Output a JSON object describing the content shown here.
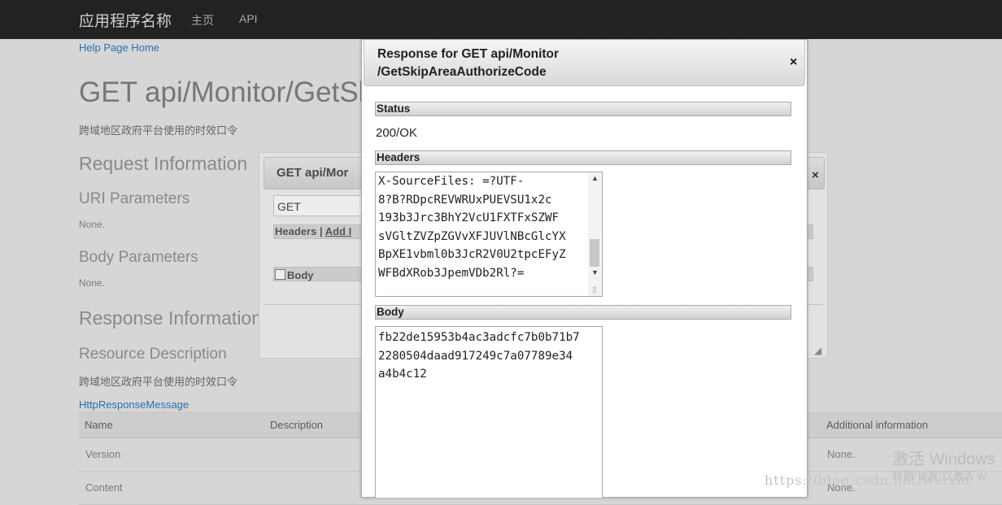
{
  "navbar": {
    "brand": "应用程序名称",
    "links": [
      "主页",
      "API"
    ]
  },
  "help_page": {
    "home_link": "Help Page Home",
    "title": "GET api/Monitor/GetSk",
    "subtitle": "跨域地区政府平台使用的时效口令",
    "request_info": "Request Information",
    "uri_params": "URI Parameters",
    "uri_params_value": "None.",
    "body_params": "Body Parameters",
    "body_params_value": "None.",
    "response_info": "Response Information",
    "resource_desc": "Resource Description",
    "resource_desc_text": "跨域地区政府平台使用的时效口令",
    "response_type_link": "HttpResponseMessage",
    "table": {
      "headers": [
        "Name",
        "Description",
        "Additional information"
      ],
      "rows": [
        {
          "name": "Version",
          "additional": "None."
        },
        {
          "name": "Content",
          "additional": "None."
        }
      ]
    }
  },
  "test_dialog": {
    "title": "GET api/Mor",
    "close": "×",
    "method": "GET",
    "headers_label": "Headers",
    "separator": "|",
    "add_label": "Add I",
    "body_label": "Body"
  },
  "response_dialog": {
    "title_line1": "Response for GET api/Monitor",
    "title_line2": "/GetSkipAreaAuthorizeCode",
    "close": "×",
    "status_label": "Status",
    "status_value": "200/OK",
    "headers_label": "Headers",
    "headers_text": "X-SourceFiles: =?UTF-\n8?B?RDpcREVWRUxPUEVSU1x2c\n193b3Jrc3BhY2VcU1FXTFxSZWF\nsVGltZVZpZGVvXFJUVlNBcGlcYX\nBpXE1vbml0b3JcR2V0U2tpcEFyZ\nWFBdXRob3JpemVDb2Rl?=",
    "body_label": "Body",
    "body_text": "fb22de15953b4ac3adcfc7b0b71b7\n2280504daad917249c7a07789e34\na4b4c12"
  },
  "overlay_text": {
    "activate_windows": "激活 Windows",
    "activate_sub": "转到\"设置\"以激活 W",
    "blog_url": "https://blog.csdn.net/weixin"
  }
}
